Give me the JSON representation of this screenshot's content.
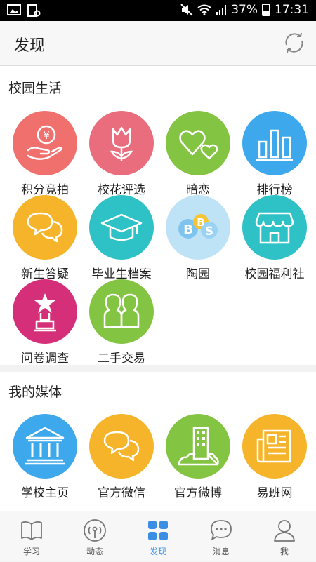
{
  "status_bar": {
    "battery": "37%",
    "time": "17:31"
  },
  "header": {
    "title": "发现"
  },
  "sections": {
    "campus_life": {
      "title": "校园生活",
      "items": [
        {
          "label": "积分竞拍",
          "icon": "hand-coin-icon",
          "color": "#f0706e"
        },
        {
          "label": "校花评选",
          "icon": "tulip-icon",
          "color": "#e96d7c"
        },
        {
          "label": "暗恋",
          "icon": "hearts-icon",
          "color": "#84c443"
        },
        {
          "label": "排行榜",
          "icon": "bar-chart-icon",
          "color": "#3ea8ec"
        },
        {
          "label": "新生答疑",
          "icon": "chat-bubbles-icon",
          "color": "#f6b42a"
        },
        {
          "label": "毕业生档案",
          "icon": "graduation-cap-icon",
          "color": "#2ec2c6"
        },
        {
          "label": "陶园",
          "icon": "bbs-icon",
          "color": "#8fcdf0"
        },
        {
          "label": "校园福利社",
          "icon": "shop-icon",
          "color": "#2ec2c6"
        },
        {
          "label": "问卷调查",
          "icon": "trophy-star-icon",
          "color": "#d52f7a"
        },
        {
          "label": "二手交易",
          "icon": "people-icon",
          "color": "#84c443"
        }
      ]
    },
    "my_media": {
      "title": "我的媒体",
      "items": [
        {
          "label": "学校主页",
          "icon": "school-building-icon",
          "color": "#3ea8ec"
        },
        {
          "label": "官方微信",
          "icon": "chat-bubbles-icon",
          "color": "#f6b42a"
        },
        {
          "label": "官方微博",
          "icon": "city-building-icon",
          "color": "#84c443"
        },
        {
          "label": "易班网",
          "icon": "newspaper-icon",
          "color": "#f6b42a"
        }
      ]
    }
  },
  "bottom_nav": [
    {
      "label": "学习",
      "icon": "book-icon",
      "active": false
    },
    {
      "label": "动态",
      "icon": "broadcast-icon",
      "active": false
    },
    {
      "label": "发现",
      "icon": "grid-icon",
      "active": true
    },
    {
      "label": "消息",
      "icon": "message-icon",
      "active": false
    },
    {
      "label": "我",
      "icon": "user-icon",
      "active": false
    }
  ],
  "colors": {
    "accent": "#3a8fe4",
    "nav_inactive": "#777777"
  }
}
